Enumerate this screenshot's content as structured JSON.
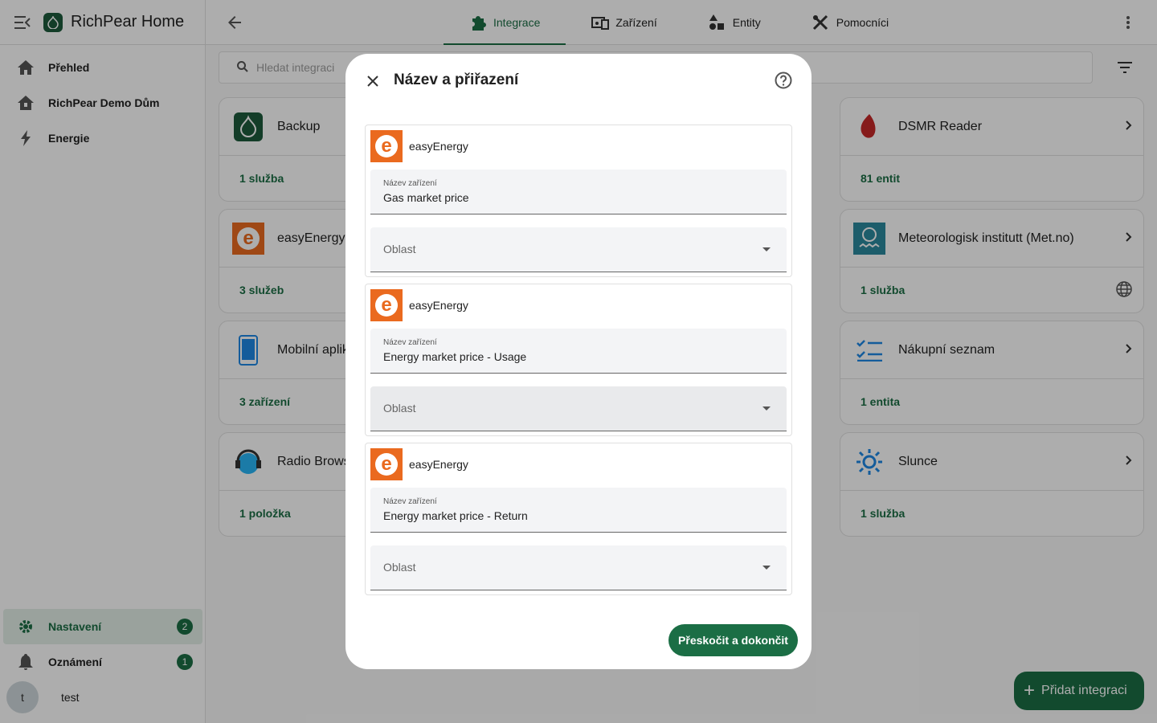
{
  "sidebar": {
    "app_title": "RichPear Home",
    "items": [
      {
        "label": "Přehled"
      },
      {
        "label": "RichPear Demo Dům"
      },
      {
        "label": "Energie"
      }
    ],
    "bottom": [
      {
        "label": "Nastavení",
        "badge": "2"
      },
      {
        "label": "Oznámení",
        "badge": "1"
      }
    ],
    "user": {
      "initial": "t",
      "name": "test"
    }
  },
  "header": {
    "tabs": [
      {
        "label": "Integrace",
        "icon": "puzzle-icon",
        "active": true
      },
      {
        "label": "Zařízení",
        "icon": "devices-icon"
      },
      {
        "label": "Entity",
        "icon": "shapes-icon"
      },
      {
        "label": "Pomocníci",
        "icon": "tools-icon"
      }
    ]
  },
  "search": {
    "placeholder": "Hledat integraci"
  },
  "cards": [
    {
      "name": "Backup",
      "count": "1 služba"
    },
    {
      "name": "DSMR Reader",
      "count": "81 entit"
    },
    {
      "name": "easyEnergy",
      "count": "3 služeb"
    },
    {
      "name": "Meteorologisk institutt (Met.no)",
      "count": "1 služba"
    },
    {
      "name": "Mobilní aplik",
      "count": "3 zařízení"
    },
    {
      "name": "Nákupní seznam",
      "count": "1 entita"
    },
    {
      "name": "Radio Brows",
      "count": "1 položka"
    },
    {
      "name": "Slunce",
      "count": "1 služba"
    }
  ],
  "fab": {
    "label": "Přidat integraci"
  },
  "dialog": {
    "title": "Název a přiřazení",
    "devices": [
      {
        "brand": "easyEnergy",
        "field_label": "Název zařízení",
        "field_value": "Gas market price",
        "area_label": "Oblast"
      },
      {
        "brand": "easyEnergy",
        "field_label": "Název zařízení",
        "field_value": "Energy market price - Usage",
        "area_label": "Oblast"
      },
      {
        "brand": "easyEnergy",
        "field_label": "Název zařízení",
        "field_value": "Energy market price - Return",
        "area_label": "Oblast"
      }
    ],
    "skip_label": "Přeskočit a dokončit",
    "logo_letter": "e"
  },
  "colors": {
    "accent": "#1b6e45",
    "brand_orange": "#ea6a1f"
  }
}
